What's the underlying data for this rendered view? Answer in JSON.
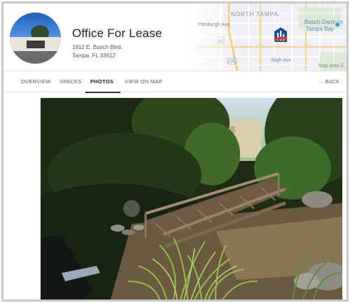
{
  "listing": {
    "title": "Office For Lease",
    "address_line1": "1912 E. Busch Blvd.",
    "address_line2": "Tampa, FL 33612"
  },
  "map": {
    "labels": {
      "north_tampa": "NORTH TAMPA",
      "busch_gardens": "Busch Gardens",
      "tampa_bay": "Tampa Bay",
      "pittsburgh": "Pittsburgh Ave",
      "sligh": "Sligh Ave",
      "map_data": "Map data ©"
    },
    "shields": {
      "us41": "41",
      "i275": "275",
      "s580": "580"
    }
  },
  "nav": {
    "tabs": [
      {
        "label": "OVERVIEW"
      },
      {
        "label": "SPACES"
      },
      {
        "label": "PHOTOS"
      },
      {
        "label": "VIEW ON MAP"
      }
    ],
    "active_tab": "PHOTOS",
    "back_label": "← BACK"
  },
  "colors": {
    "accent": "#333333",
    "map_brand": "#1f4e9b",
    "map_brand_red": "#d6392b"
  },
  "icons": {
    "brand": "building-logo-icon",
    "map_pin": "map-pin-icon"
  }
}
